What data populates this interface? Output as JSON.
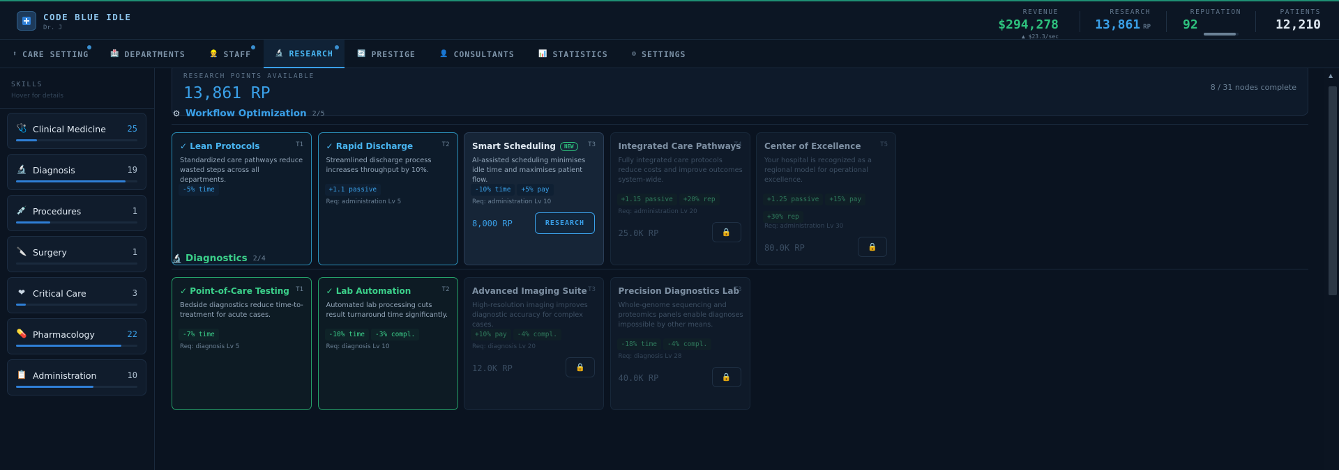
{
  "app": {
    "title": "CODE BLUE IDLE",
    "player": "Dr. J"
  },
  "stats": {
    "revenue": {
      "label": "REVENUE",
      "value": "$294,278",
      "rate": "▲ $23.3/sec"
    },
    "research": {
      "label": "RESEARCH",
      "value": "13,861",
      "unit": "RP"
    },
    "reputation": {
      "label": "REPUTATION",
      "value": "92",
      "level": 0.92
    },
    "patients": {
      "label": "PATIENTS",
      "value": "12,210"
    }
  },
  "tabs": [
    {
      "icon": "⬆",
      "label": "CARE SETTING",
      "dot": true
    },
    {
      "icon": "🏥",
      "label": "DEPARTMENTS",
      "dot": false
    },
    {
      "icon": "👷",
      "label": "STAFF",
      "dot": true
    },
    {
      "icon": "🔬",
      "label": "RESEARCH",
      "dot": true,
      "active": true
    },
    {
      "icon": "🔄",
      "label": "PRESTIGE",
      "dot": false
    },
    {
      "icon": "👤",
      "label": "CONSULTANTS",
      "dot": false
    },
    {
      "icon": "📊",
      "label": "STATISTICS",
      "dot": false
    },
    {
      "icon": "⚙",
      "label": "SETTINGS",
      "dot": false
    }
  ],
  "sidebar": {
    "title": "SKILLS",
    "hint": "Hover for details",
    "skills": [
      {
        "icon": "🩺",
        "name": "Clinical Medicine",
        "level": "25",
        "progress": 0.17,
        "highlight": true
      },
      {
        "icon": "🔬",
        "name": "Diagnosis",
        "level": "19",
        "progress": 0.9,
        "highlight": false
      },
      {
        "icon": "💉",
        "name": "Procedures",
        "level": "1",
        "progress": 0.28,
        "highlight": false
      },
      {
        "icon": "🔪",
        "name": "Surgery",
        "level": "1",
        "progress": 0.0,
        "highlight": false
      },
      {
        "icon": "❤",
        "name": "Critical Care",
        "level": "3",
        "progress": 0.08,
        "highlight": false
      },
      {
        "icon": "💊",
        "name": "Pharmacology",
        "level": "22",
        "progress": 0.87,
        "highlight": true
      },
      {
        "icon": "📋",
        "name": "Administration",
        "level": "10",
        "progress": 0.64,
        "highlight": false
      }
    ]
  },
  "research_box": {
    "label": "RESEARCH POINTS AVAILABLE",
    "value": "13,861 RP",
    "nodes": "8 / 31 nodes complete"
  },
  "sections": [
    {
      "icon": "⚙",
      "title": "Workflow Optimization",
      "count": "2/5",
      "color": "#3aa0e8",
      "nodes": [
        {
          "state": "done-blue",
          "title": "✓ Lean Protocols",
          "tier": "T1",
          "desc": "Standardized care pathways reduce wasted steps across all departments.",
          "chips": [
            "-5% time"
          ],
          "req": "",
          "cost": ""
        },
        {
          "state": "done-blue",
          "title": "✓ Rapid Discharge",
          "tier": "T2",
          "desc": "Streamlined discharge process increases throughput by 10%.",
          "chips": [
            "+1.1 passive"
          ],
          "req": "Req: administration Lv 5",
          "cost": ""
        },
        {
          "state": "avail",
          "title": "Smart Scheduling",
          "new": "NEW",
          "tier": "T3",
          "desc": "AI-assisted scheduling minimises idle time and maximises patient flow.",
          "chips": [
            "-10% time",
            "+5% pay"
          ],
          "req": "Req: administration Lv 10",
          "cost": "8,000 RP",
          "button": "RESEARCH"
        },
        {
          "state": "locked",
          "title": "Integrated Care Pathways",
          "tier": "T4",
          "desc": "Fully integrated care protocols reduce costs and improve outcomes system-wide.",
          "chips": [
            "+1.15 passive",
            "+20% rep"
          ],
          "req": "Req: administration Lv 20",
          "cost": "25.0K RP"
        },
        {
          "state": "locked",
          "title": "Center of Excellence",
          "tier": "T5",
          "desc": "Your hospital is recognized as a regional model for operational excellence.",
          "chips": [
            "+1.25 passive",
            "+15% pay",
            "+30% rep"
          ],
          "req": "Req: administration Lv 30",
          "cost": "80.0K RP"
        }
      ]
    },
    {
      "icon": "🔬",
      "title": "Diagnostics",
      "count": "2/4",
      "color": "#3bd08a",
      "nodes": [
        {
          "state": "done-green",
          "title": "✓ Point-of-Care Testing",
          "tier": "T1",
          "desc": "Bedside diagnostics reduce time-to-treatment for acute cases.",
          "chips": [
            "-7% time"
          ],
          "req": "Req: diagnosis Lv 5",
          "cost": ""
        },
        {
          "state": "done-green",
          "title": "✓ Lab Automation",
          "tier": "T2",
          "desc": "Automated lab processing cuts result turnaround time significantly.",
          "chips": [
            "-10% time",
            "-3% compl."
          ],
          "req": "Req: diagnosis Lv 10",
          "cost": ""
        },
        {
          "state": "locked",
          "title": "Advanced Imaging Suite",
          "tier": "T3",
          "desc": "High-resolution imaging improves diagnostic accuracy for complex cases.",
          "chips": [
            "+10% pay",
            "-4% compl."
          ],
          "req": "Req: diagnosis Lv 20",
          "cost": "12.0K RP"
        },
        {
          "state": "locked",
          "title": "Precision Diagnostics Lab",
          "tier": "T3",
          "desc": "Whole-genome sequencing and proteomics panels enable diagnoses impossible by other means.",
          "chips": [
            "-18% time",
            "-4% compl."
          ],
          "req": "Req: diagnosis Lv 28",
          "cost": "40.0K RP"
        }
      ]
    }
  ]
}
